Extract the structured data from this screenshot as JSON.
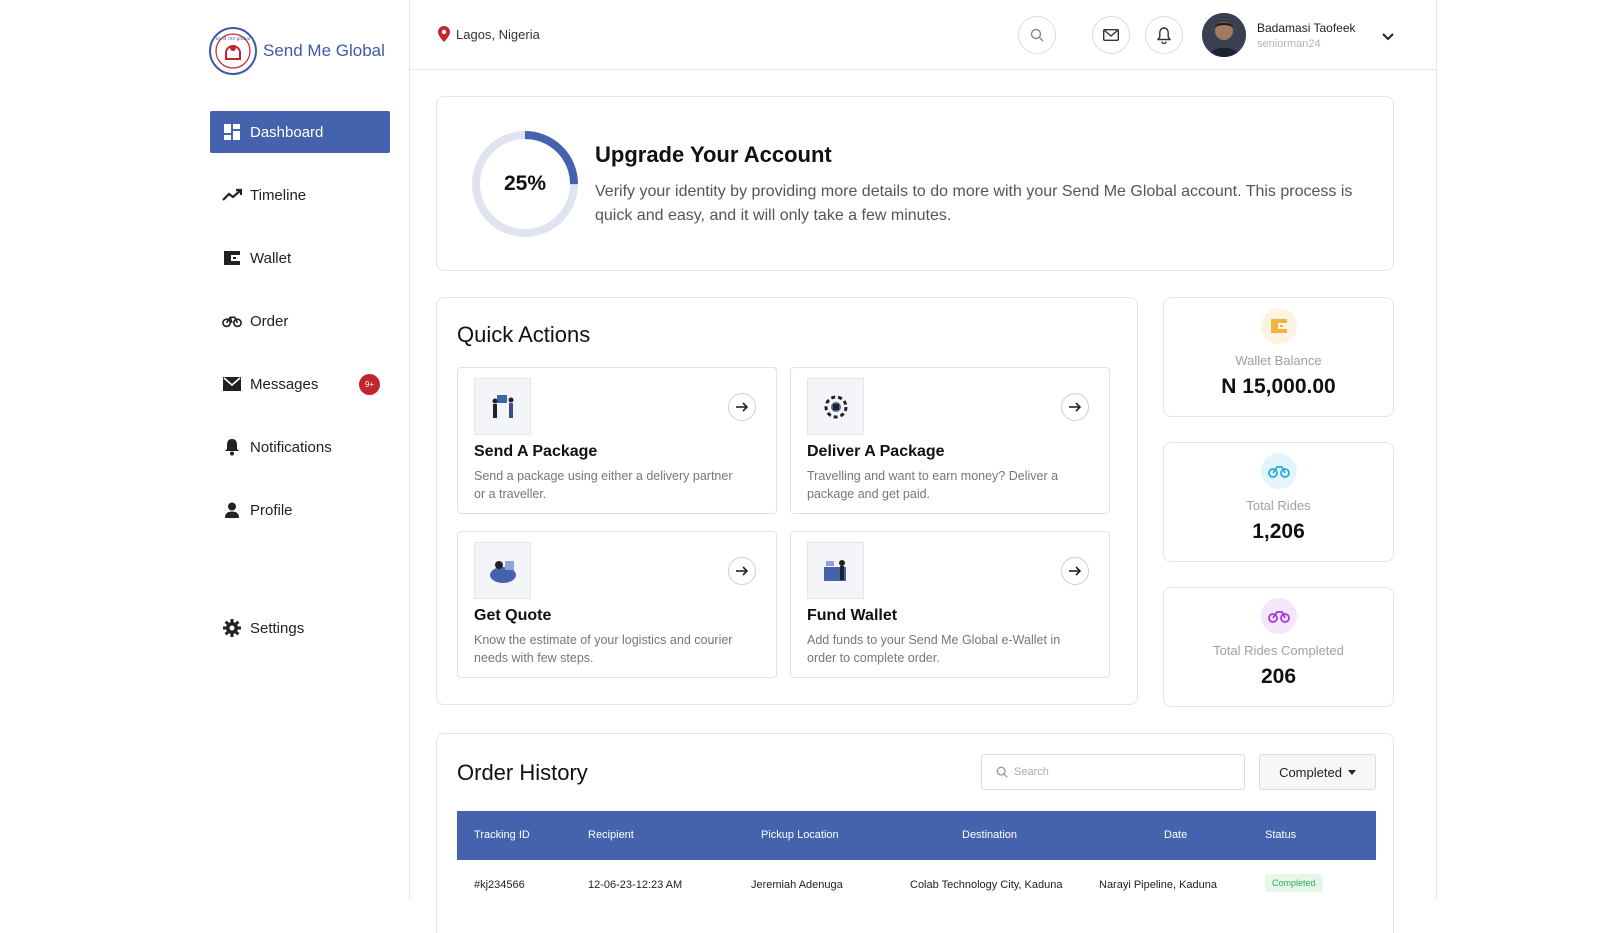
{
  "brand": {
    "name": "Send Me Global",
    "accent": "#4563ad",
    "logo_text": "send me global"
  },
  "sidebar": {
    "items": [
      {
        "label": "Dashboard",
        "icon": "dashboard-icon",
        "active": true
      },
      {
        "label": "Timeline",
        "icon": "trend-icon"
      },
      {
        "label": "Wallet",
        "icon": "wallet-icon"
      },
      {
        "label": "Order",
        "icon": "bicycle-icon"
      },
      {
        "label": "Messages",
        "icon": "mail-icon",
        "badge": "9+"
      },
      {
        "label": "Notifications",
        "icon": "bell-icon"
      },
      {
        "label": "Profile",
        "icon": "person-icon"
      }
    ],
    "settings": {
      "label": "Settings",
      "icon": "gear-icon"
    }
  },
  "topbar": {
    "location": "Lagos, Nigeria",
    "user": {
      "name": "Badamasi Taofeek",
      "handle": "seniorman24"
    }
  },
  "upgrade": {
    "progress_label": "25%",
    "progress_fraction": 0.25,
    "title": "Upgrade Your Account",
    "description": "Verify your identity by providing more details to do more with your Send Me Global account. This process is quick and easy, and it will only take a few minutes."
  },
  "quick_actions": {
    "title": "Quick Actions",
    "items": [
      {
        "title": "Send A Package",
        "description": "Send a package using either a delivery partner or a traveller."
      },
      {
        "title": "Deliver A Package",
        "description": "Travelling and want to earn money? Deliver a package and get paid."
      },
      {
        "title": "Get Quote",
        "description": "Know the estimate of your logistics and courier needs with few steps."
      },
      {
        "title": "Fund Wallet",
        "description": "Add funds to your Send Me Global e-Wallet in order to complete order."
      }
    ]
  },
  "stats": [
    {
      "label": "Wallet Balance",
      "value": "N 15,000.00",
      "icon": "wallet-icon",
      "color": "#f2b441"
    },
    {
      "label": "Total Rides",
      "value": "1,206",
      "icon": "bicycle-icon",
      "color": "#29a9e0"
    },
    {
      "label": "Total Rides Completed",
      "value": "206",
      "icon": "bicycle-icon",
      "color": "#a43ad6"
    }
  ],
  "order_history": {
    "title": "Order History",
    "search_placeholder": "Search",
    "filter": "Completed",
    "columns": [
      "Tracking ID",
      "Recipient",
      "Pickup Location",
      "Destination",
      "Date",
      "Status"
    ],
    "rows": [
      {
        "tracking_id": "#kj234566",
        "recipient": "12-06-23-12:23 AM",
        "pickup": "Jeremiah Adenuga",
        "destination": "Colab Technology City, Kaduna",
        "date": "Narayi Pipeline, Kaduna",
        "status": "Completed"
      }
    ]
  }
}
